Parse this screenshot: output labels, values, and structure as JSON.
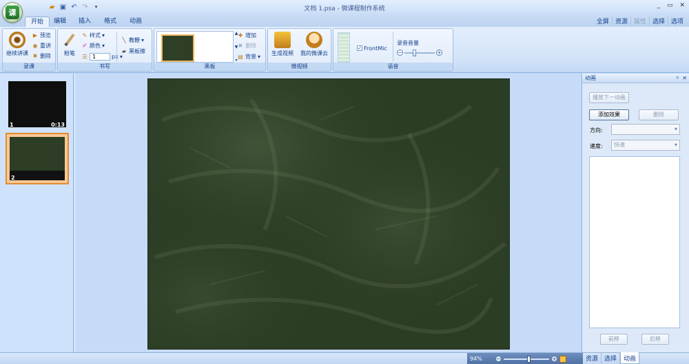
{
  "window": {
    "title": "文档 1.psa - 微课程制作系统",
    "controls": [
      "_",
      "▭",
      "✕"
    ]
  },
  "tabs": [
    "开始",
    "编辑",
    "插入",
    "格式",
    "动画"
  ],
  "active_tab": "开始",
  "right_menu": [
    "全屏",
    "资源",
    "属性",
    "选择",
    "选项"
  ],
  "ribbon": {
    "record": {
      "label": "录课",
      "continue": "继续讲课",
      "preview": "预览",
      "rerecord": "重讲",
      "delete": "删除"
    },
    "write": {
      "label": "书写",
      "chalk": "粉笔",
      "style": "样式",
      "color": "颜色",
      "width_value": "1",
      "width_unit": "px",
      "pointer": "教鞭",
      "eraser": "黑板擦"
    },
    "board": {
      "label": "黑板",
      "add": "增加",
      "delete": "删除",
      "background": "背景"
    },
    "microvideo": {
      "label": "微视频",
      "generate": "生成视频",
      "cloud": "我的微课云"
    },
    "voice": {
      "label": "语音",
      "mic": "FrontMic",
      "mic_checked": "✓",
      "volume": "录音音量",
      "volume_level": 0.3
    }
  },
  "slides": [
    {
      "num": "1",
      "duration": "0:13"
    },
    {
      "num": "2",
      "duration": ""
    }
  ],
  "pane": {
    "title": "动画",
    "play_next": "播放下一动画",
    "add_effect": "添加效果",
    "delete": "删除",
    "direction_label": "方向:",
    "direction_value": "",
    "speed_label": "速度:",
    "speed_value": "快速",
    "move_up": "前移",
    "move_down": "后移"
  },
  "status": {
    "zoom": "94%",
    "zoom_level": 0.55
  },
  "pane_tabs": [
    "资源",
    "选择",
    "动画"
  ],
  "colors": {
    "chalkboard": "#2c3d25",
    "accent": "#e28b32",
    "ribbon": "#d3e3f8"
  }
}
